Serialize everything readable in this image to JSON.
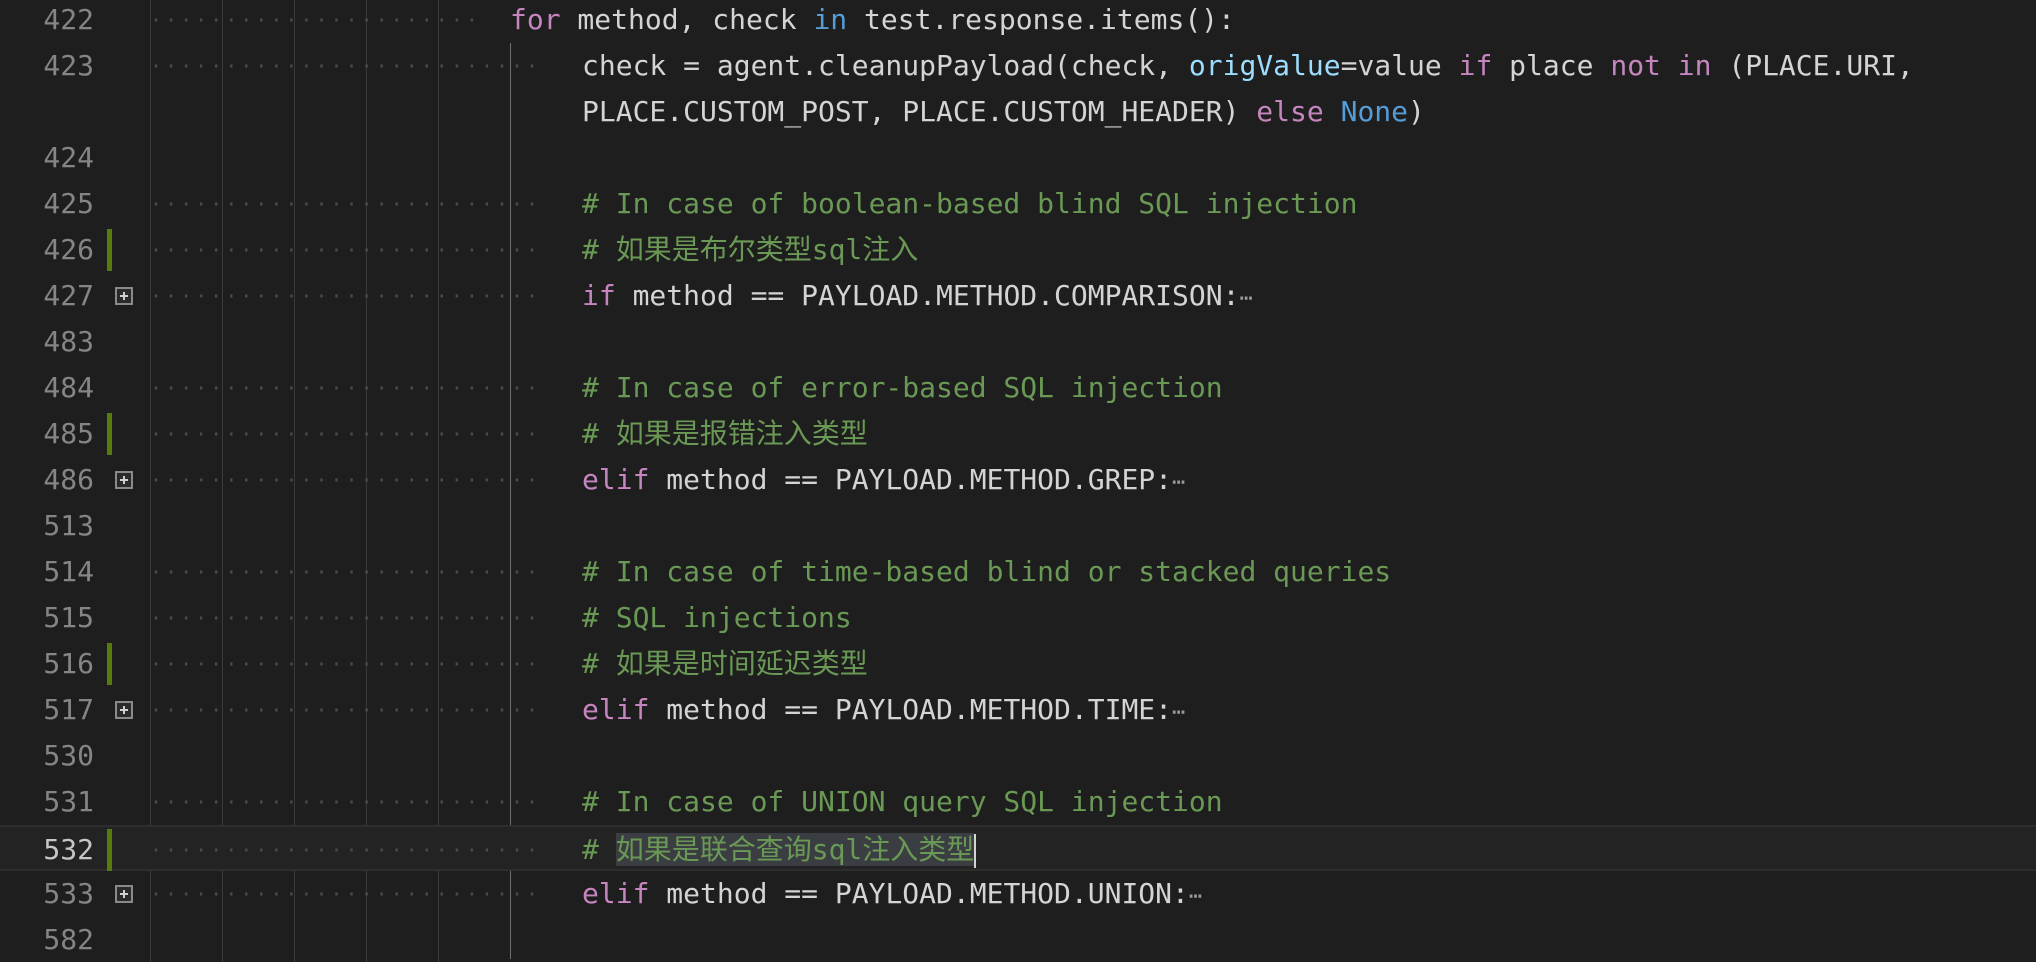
{
  "editor": {
    "lines": [
      {
        "n": "422",
        "indent": 5,
        "marker": false,
        "fold": false,
        "tokens": [
          {
            "t": "for",
            "c": "kw-ctrl"
          },
          {
            "t": " method, check ",
            "c": "plain"
          },
          {
            "t": "in",
            "c": "kw"
          },
          {
            "t": " test.response.items():",
            "c": "plain"
          }
        ]
      },
      {
        "n": "423",
        "indent": 6,
        "marker": false,
        "fold": false,
        "tokens": [
          {
            "t": "check = agent.cleanupPayload(check, ",
            "c": "plain"
          },
          {
            "t": "origValue",
            "c": "param"
          },
          {
            "t": "=value ",
            "c": "plain"
          },
          {
            "t": "if",
            "c": "kw-ctrl"
          },
          {
            "t": " place ",
            "c": "plain"
          },
          {
            "t": "not",
            "c": "kw-ctrl"
          },
          {
            "t": " ",
            "c": "plain"
          },
          {
            "t": "in",
            "c": "kw-ctrl"
          },
          {
            "t": " (PLACE.URI,",
            "c": "plain"
          }
        ]
      },
      {
        "n": "",
        "indent": 6,
        "marker": false,
        "fold": false,
        "wrap": true,
        "tokens": [
          {
            "t": "PLACE.CUSTOM_POST, PLACE.CUSTOM_HEADER) ",
            "c": "plain"
          },
          {
            "t": "else",
            "c": "kw-ctrl"
          },
          {
            "t": " ",
            "c": "plain"
          },
          {
            "t": "None",
            "c": "kw"
          },
          {
            "t": ")",
            "c": "plain"
          }
        ]
      },
      {
        "n": "424",
        "indent": 0,
        "marker": false,
        "fold": false,
        "tokens": []
      },
      {
        "n": "425",
        "indent": 6,
        "marker": false,
        "fold": false,
        "tokens": [
          {
            "t": "# In case of boolean-based blind SQL injection",
            "c": "comment"
          }
        ]
      },
      {
        "n": "426",
        "indent": 6,
        "marker": true,
        "fold": false,
        "tokens": [
          {
            "t": "# 如果是布尔类型sql注入",
            "c": "comment"
          }
        ]
      },
      {
        "n": "427",
        "indent": 6,
        "marker": false,
        "fold": true,
        "tokens": [
          {
            "t": "if",
            "c": "kw-ctrl"
          },
          {
            "t": " method == PAYLOAD.METHOD.COMPARISON:",
            "c": "plain"
          },
          {
            "t": "⋯",
            "c": "ellipsis"
          }
        ]
      },
      {
        "n": "483",
        "indent": 0,
        "marker": false,
        "fold": false,
        "tokens": []
      },
      {
        "n": "484",
        "indent": 6,
        "marker": false,
        "fold": false,
        "tokens": [
          {
            "t": "# In case of error-based SQL injection",
            "c": "comment"
          }
        ]
      },
      {
        "n": "485",
        "indent": 6,
        "marker": true,
        "fold": false,
        "tokens": [
          {
            "t": "# 如果是报错注入类型",
            "c": "comment"
          }
        ]
      },
      {
        "n": "486",
        "indent": 6,
        "marker": false,
        "fold": true,
        "tokens": [
          {
            "t": "elif",
            "c": "kw-ctrl"
          },
          {
            "t": " method == PAYLOAD.METHOD.GREP:",
            "c": "plain"
          },
          {
            "t": "⋯",
            "c": "ellipsis"
          }
        ]
      },
      {
        "n": "513",
        "indent": 0,
        "marker": false,
        "fold": false,
        "tokens": []
      },
      {
        "n": "514",
        "indent": 6,
        "marker": false,
        "fold": false,
        "tokens": [
          {
            "t": "# In case of time-based blind or stacked queries",
            "c": "comment"
          }
        ]
      },
      {
        "n": "515",
        "indent": 6,
        "marker": false,
        "fold": false,
        "tokens": [
          {
            "t": "# SQL injections",
            "c": "comment"
          }
        ]
      },
      {
        "n": "516",
        "indent": 6,
        "marker": true,
        "fold": false,
        "tokens": [
          {
            "t": "# 如果是时间延迟类型",
            "c": "comment"
          }
        ]
      },
      {
        "n": "517",
        "indent": 6,
        "marker": false,
        "fold": true,
        "tokens": [
          {
            "t": "elif",
            "c": "kw-ctrl"
          },
          {
            "t": " method == PAYLOAD.METHOD.TIME:",
            "c": "plain"
          },
          {
            "t": "⋯",
            "c": "ellipsis"
          }
        ]
      },
      {
        "n": "530",
        "indent": 0,
        "marker": false,
        "fold": false,
        "tokens": []
      },
      {
        "n": "531",
        "indent": 6,
        "marker": false,
        "fold": false,
        "tokens": [
          {
            "t": "# In case of UNION query SQL injection",
            "c": "comment"
          }
        ]
      },
      {
        "n": "532",
        "indent": 6,
        "marker": true,
        "fold": false,
        "current": true,
        "tokens": [
          {
            "t": "# ",
            "c": "comment"
          },
          {
            "t": "如果是联合查询sql注入类型",
            "c": "comment selected"
          }
        ]
      },
      {
        "n": "533",
        "indent": 6,
        "marker": false,
        "fold": true,
        "tokens": [
          {
            "t": "elif",
            "c": "kw-ctrl"
          },
          {
            "t": " method == PAYLOAD.METHOD.UNION:",
            "c": "plain"
          },
          {
            "t": "⋯",
            "c": "ellipsis"
          }
        ]
      },
      {
        "n": "582",
        "indent": 0,
        "marker": false,
        "fold": false,
        "tokens": []
      }
    ]
  },
  "colors": {
    "background": "#1e1e1e",
    "line_number": "#858585",
    "keyword_control": "#c586c0",
    "keyword": "#569cd6",
    "parameter": "#9cdcfe",
    "comment": "#6a9955",
    "text": "#d4d4d4",
    "modified_marker": "#587c0c"
  }
}
